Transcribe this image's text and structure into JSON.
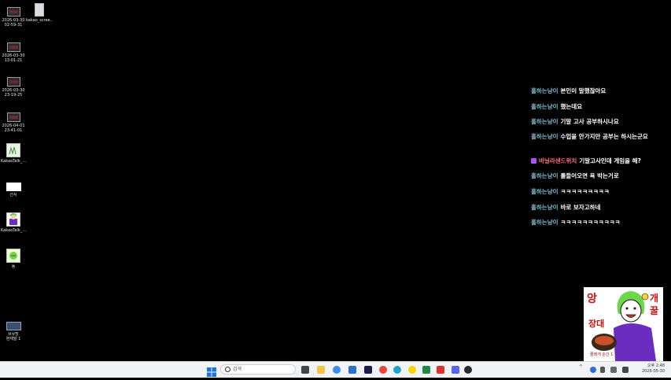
{
  "desktop": {
    "icons": [
      {
        "label": "2026-03-30\n02-59-31",
        "kind": "video"
      },
      {
        "label": "kakao_scree...",
        "kind": "image"
      },
      {
        "label": "2026-03-30\n13-01-21",
        "kind": "video"
      },
      {
        "label": "2026-03-30\n23-19-25",
        "kind": "video"
      },
      {
        "label": "2026-04-01\n23-41-01",
        "kind": "video"
      },
      {
        "label": "KakaoTalk_...",
        "kind": "image"
      },
      {
        "label": "선서",
        "kind": "image"
      },
      {
        "label": "KakaoTalk_...",
        "kind": "image"
      },
      {
        "label": "똥",
        "kind": "image"
      },
      {
        "label": "브유방\n현재말 1",
        "kind": "video"
      }
    ]
  },
  "chat": {
    "messages": [
      {
        "user": "홀하는냥이",
        "text": "본인이 말했잖아요"
      },
      {
        "user": "홀하는냥이",
        "text": "했는데요"
      },
      {
        "user": "홀하는냥이",
        "text": "기말 고사 공부하시나요"
      },
      {
        "user": "홀하는냥이",
        "text": "수업을 안가지만 공부는 하시는군요"
      },
      {
        "user": "바닐라샌드위치",
        "text": "기말고사인데 게임을 해?",
        "badge": true
      },
      {
        "user": "홀하는냥이",
        "text": "롤들어오면 욕 박는거로"
      },
      {
        "user": "홀하는냥이",
        "text": "ㅋㅋㅋㅋㅋㅋㅋㅋㅋ"
      },
      {
        "user": "홀하는냥이",
        "text": "바로 보자고하네"
      },
      {
        "user": "홀하는냥이",
        "text": "ㅋㅋㅋㅋㅋㅋㅋㅋㅋㅋㅋ"
      }
    ]
  },
  "sticker": {
    "left_text": "앙",
    "middle_text": "장대",
    "right_text": "개꿀",
    "caption": "줄래개 순간 1"
  },
  "taskbar": {
    "search_placeholder": "검색",
    "clock_time": "오후 2:48",
    "clock_date": "2026-05-30",
    "tray_chevron": "^"
  },
  "colors": {
    "username": "#7fb3c8",
    "username_alt": "#ff6b7a",
    "badge": "#a855f7",
    "taskbar": "#f1f3f7"
  }
}
